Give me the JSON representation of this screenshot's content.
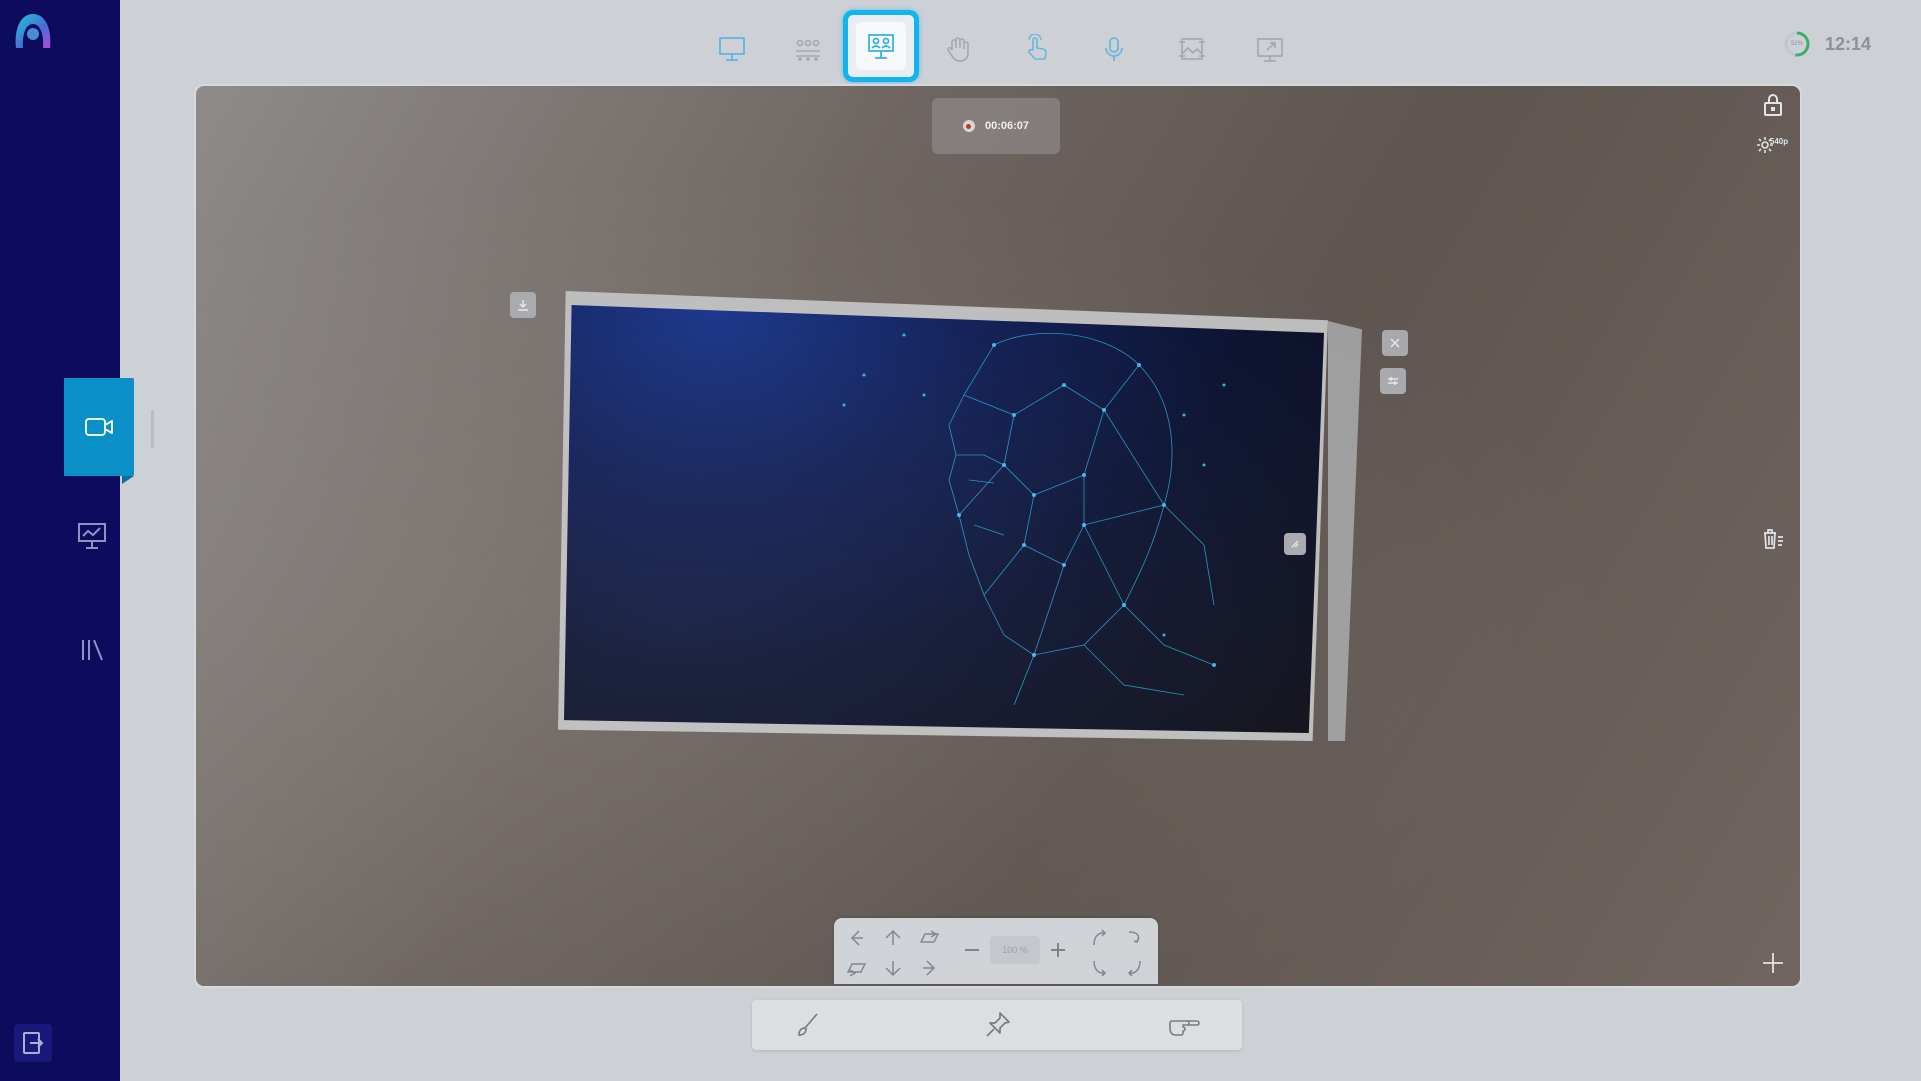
{
  "recording": {
    "time": "00:06:07"
  },
  "status": {
    "battery": "52%",
    "clock": "12:14"
  },
  "view": {
    "quality": "540p",
    "zoom": "100 %"
  },
  "toolbar": {
    "selected": "mode-3d-presentation",
    "items": [
      "presentation",
      "audience-grid",
      "3d-presentation",
      "hand",
      "touch",
      "microphone",
      "image-frame",
      "share-screen"
    ]
  },
  "sidebar": {
    "items": [
      "video-camera",
      "presentation-chart",
      "library"
    ],
    "active": "video-camera"
  },
  "bottom_tools": [
    "brush",
    "pin",
    "pointer-hand"
  ],
  "colors": {
    "sidebar": "#0c0b5e",
    "accent": "#0a8fc7",
    "selection": "#11b4ef",
    "record": "#c8332d"
  }
}
